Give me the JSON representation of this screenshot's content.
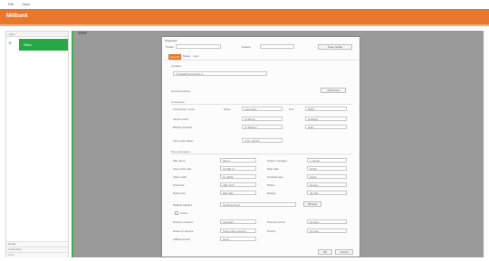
{
  "window": {
    "title_items": [
      "File",
      "View"
    ]
  },
  "app": {
    "name": "Millbank",
    "accent": "#e8762b"
  },
  "sidebar": {
    "header": "Sites",
    "item_label": "Sites",
    "status_lines": [
      "Ready",
      "Connected",
      "v 2.4"
    ]
  },
  "dialog": {
    "title": "Properties",
    "header_label": "Profile",
    "header_check_label": "Default",
    "header_button": "Save profile",
    "tabs": [
      "General",
      "Notes",
      "Log"
    ],
    "path_label": "Location",
    "path_value": "C:\\Data\\Projects\\Site A",
    "options_label": "General options",
    "options_button": "Advanced",
    "section1": {
      "title": "Connection",
      "rows": [
        {
          "label": "Connection mode",
          "left_label": "Mode",
          "left_value": "Automatic",
          "right_label": "Port",
          "right_value": "8080"
        },
        {
          "label": "Server name",
          "left_value": "localhost",
          "right_value": "Enabled"
        },
        {
          "label": "Backup location",
          "left_value": "D:\\Backup",
          "right_value": "Daily"
        },
        {
          "label": "Time zone offset",
          "left_value": "UTC +00:00"
        }
      ]
    },
    "section2": {
      "title": "Site parameters",
      "rows": [
        {
          "l1": "Site name",
          "v1": "Site A",
          "l2": "Project manager",
          "v2": "J. Smith"
        },
        {
          "l1": "Area of the site",
          "v1": "12,500 m²",
          "l2": "Start date",
          "v2": "01/03"
        },
        {
          "l1": "Client code",
          "v1": "CL-0042",
          "l2": "Contract type",
          "v2": "Fixed"
        },
        {
          "l1": "Postcode",
          "v1": "AB1 2CD",
          "l2": "Phase",
          "v2": "Design"
        },
        {
          "l1": "Reference",
          "v1": "REF-881",
          "l2": "Budget",
          "v2": "45,000"
        }
      ],
      "wide_row": {
        "label": "Default supplier",
        "value": "Northwind Ltd",
        "button": "Browse"
      },
      "check_label": "Active",
      "row7": {
        "l1": "Delivery method",
        "v1": "Standard",
        "l2": "Payment terms",
        "v2": "30 days"
      },
      "row8": {
        "l1": "Notes on access",
        "v1": "Gate code required",
        "l2": "Priority",
        "v2": "Normal"
      },
      "row9": {
        "l1": "Additional info",
        "v1": "None"
      }
    },
    "ok": "OK",
    "cancel": "Cancel"
  }
}
